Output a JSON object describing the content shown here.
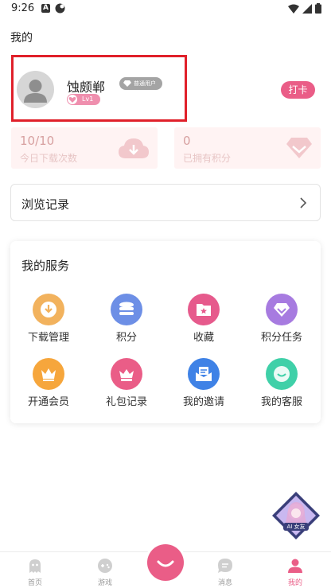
{
  "status_bar": {
    "time": "9:26",
    "a_icon_letter": "A"
  },
  "page_title": "我的",
  "profile": {
    "username": "蚀颇郸",
    "user_type": "普通用户",
    "level": "Lv1",
    "checkin_label": "打卡"
  },
  "stats": {
    "downloads_value": "10/10",
    "downloads_label": "今日下载次数",
    "points_value": "0",
    "points_label": "已拥有积分"
  },
  "history": {
    "label": "浏览记录"
  },
  "services": {
    "title": "我的服务",
    "items": [
      {
        "label": "下载管理",
        "icon": "download-icon",
        "color": "#f2b25d"
      },
      {
        "label": "积分",
        "icon": "coins-icon",
        "color": "#6d8fe6"
      },
      {
        "label": "收藏",
        "icon": "favorites-icon",
        "color": "#e65a8c"
      },
      {
        "label": "积分任务",
        "icon": "tag-icon",
        "color": "#a77be0"
      },
      {
        "label": "开通会员",
        "icon": "crown-icon",
        "color": "#f6a63c"
      },
      {
        "label": "礼包记录",
        "icon": "gift-crown-icon",
        "color": "#ea5d87"
      },
      {
        "label": "我的邀请",
        "icon": "mail-icon",
        "color": "#3f82e6"
      },
      {
        "label": "我的客服",
        "icon": "chat-icon",
        "color": "#3fd0a8"
      }
    ]
  },
  "ai_float": {
    "label": "AI 女友"
  },
  "bottom_nav": {
    "items": [
      {
        "label": "首页",
        "icon": "ghost-icon"
      },
      {
        "label": "游戏",
        "icon": "gamepad-icon"
      },
      {
        "label": "消息",
        "icon": "message-icon"
      },
      {
        "label": "我的",
        "icon": "user-icon",
        "active": true
      }
    ]
  },
  "colors": {
    "accent": "#ea5d87",
    "highlight_border": "#e0202a",
    "stat_bg": "#fff3f3"
  }
}
